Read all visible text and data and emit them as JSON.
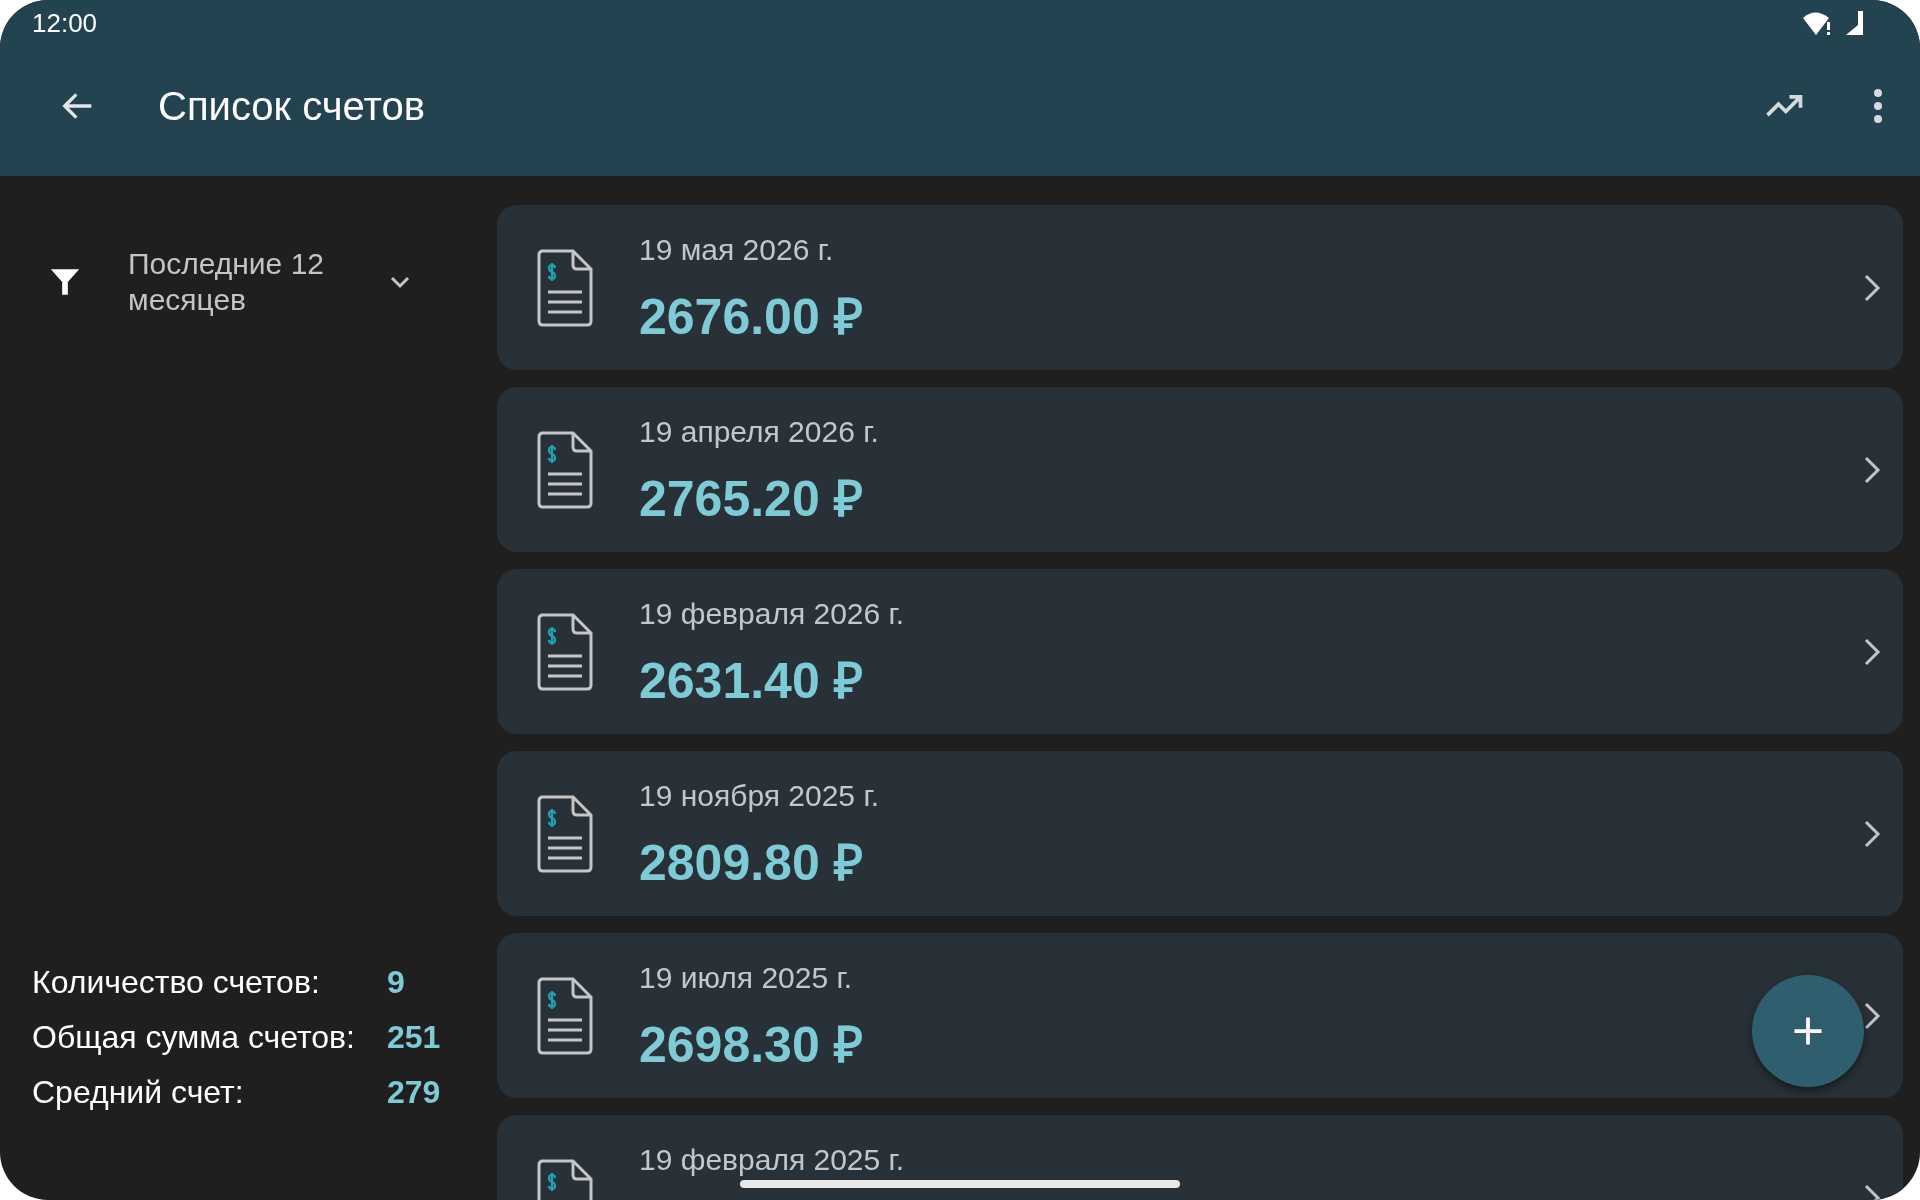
{
  "status_bar": {
    "time": "12:00"
  },
  "app_bar": {
    "title": "Список счетов"
  },
  "filter": {
    "label": "Последние 12 месяцев"
  },
  "summary": [
    {
      "label": "Количество счетов:",
      "value": "9"
    },
    {
      "label": "Общая сумма счетов:",
      "value": "251"
    },
    {
      "label": "Средний счет:",
      "value": "279"
    }
  ],
  "invoices": [
    {
      "date": "19 мая 2026 г.",
      "amount": "2676.00 ₽"
    },
    {
      "date": "19 апреля 2026 г.",
      "amount": "2765.20 ₽"
    },
    {
      "date": "19 февраля 2026 г.",
      "amount": "2631.40 ₽"
    },
    {
      "date": "19 ноября 2025 г.",
      "amount": "2809.80 ₽"
    },
    {
      "date": "19 июля 2025 г.",
      "amount": "2698.30 ₽"
    },
    {
      "date": "19 февраля 2025 г."
    }
  ]
}
